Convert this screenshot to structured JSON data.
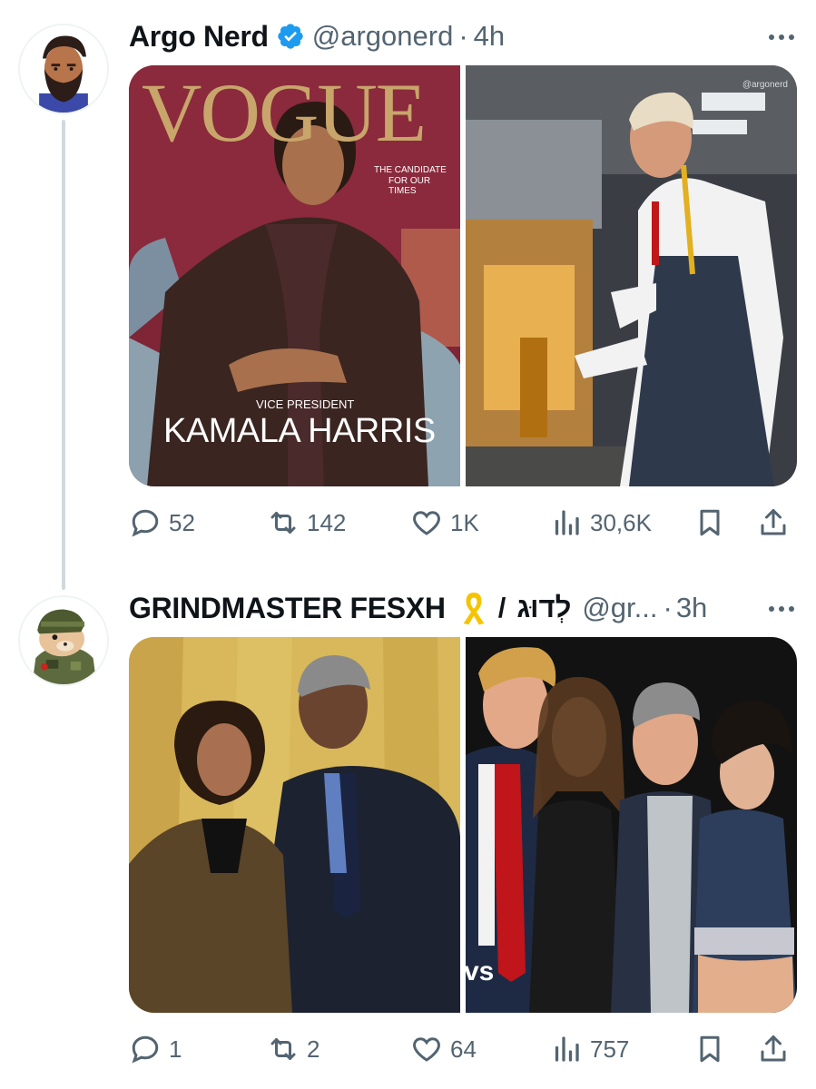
{
  "tweets": [
    {
      "display_name": "Argo Nerd",
      "handle": "@argonerd",
      "dot": "·",
      "time": "4h",
      "verified": true,
      "media": [
        {
          "masthead": "VOGUE",
          "tagline_1": "THE CANDIDATE",
          "tagline_2": "FOR OUR TIMES",
          "role": "VICE PRESIDENT",
          "name": "KAMALA HARRIS"
        },
        {
          "watermark": "@argonerd"
        }
      ],
      "stats": {
        "replies": "52",
        "reposts": "142",
        "likes": "1K",
        "views": "30,6K"
      }
    },
    {
      "display_name": "GRINDMASTER FESXH",
      "separator": "/",
      "hebrew": "לְדוּג",
      "handle": "@gr...",
      "dot": "·",
      "time": "3h",
      "media": [
        {},
        {
          "corner_text": "vs"
        }
      ],
      "stats": {
        "replies": "1",
        "reposts": "2",
        "likes": "64",
        "views": "757"
      }
    }
  ],
  "icons": {
    "reply": "reply-icon",
    "repost": "repost-icon",
    "like": "heart-icon",
    "views": "views-chart-icon",
    "bookmark": "bookmark-icon",
    "share": "share-icon",
    "more": "more-dots-icon",
    "verified": "verified-badge-icon",
    "ribbon": "yellow-ribbon-icon"
  },
  "colors": {
    "text": "#0f1419",
    "secondary": "#536471",
    "verified": "#1d9bf0",
    "thread": "#cfd9de"
  }
}
